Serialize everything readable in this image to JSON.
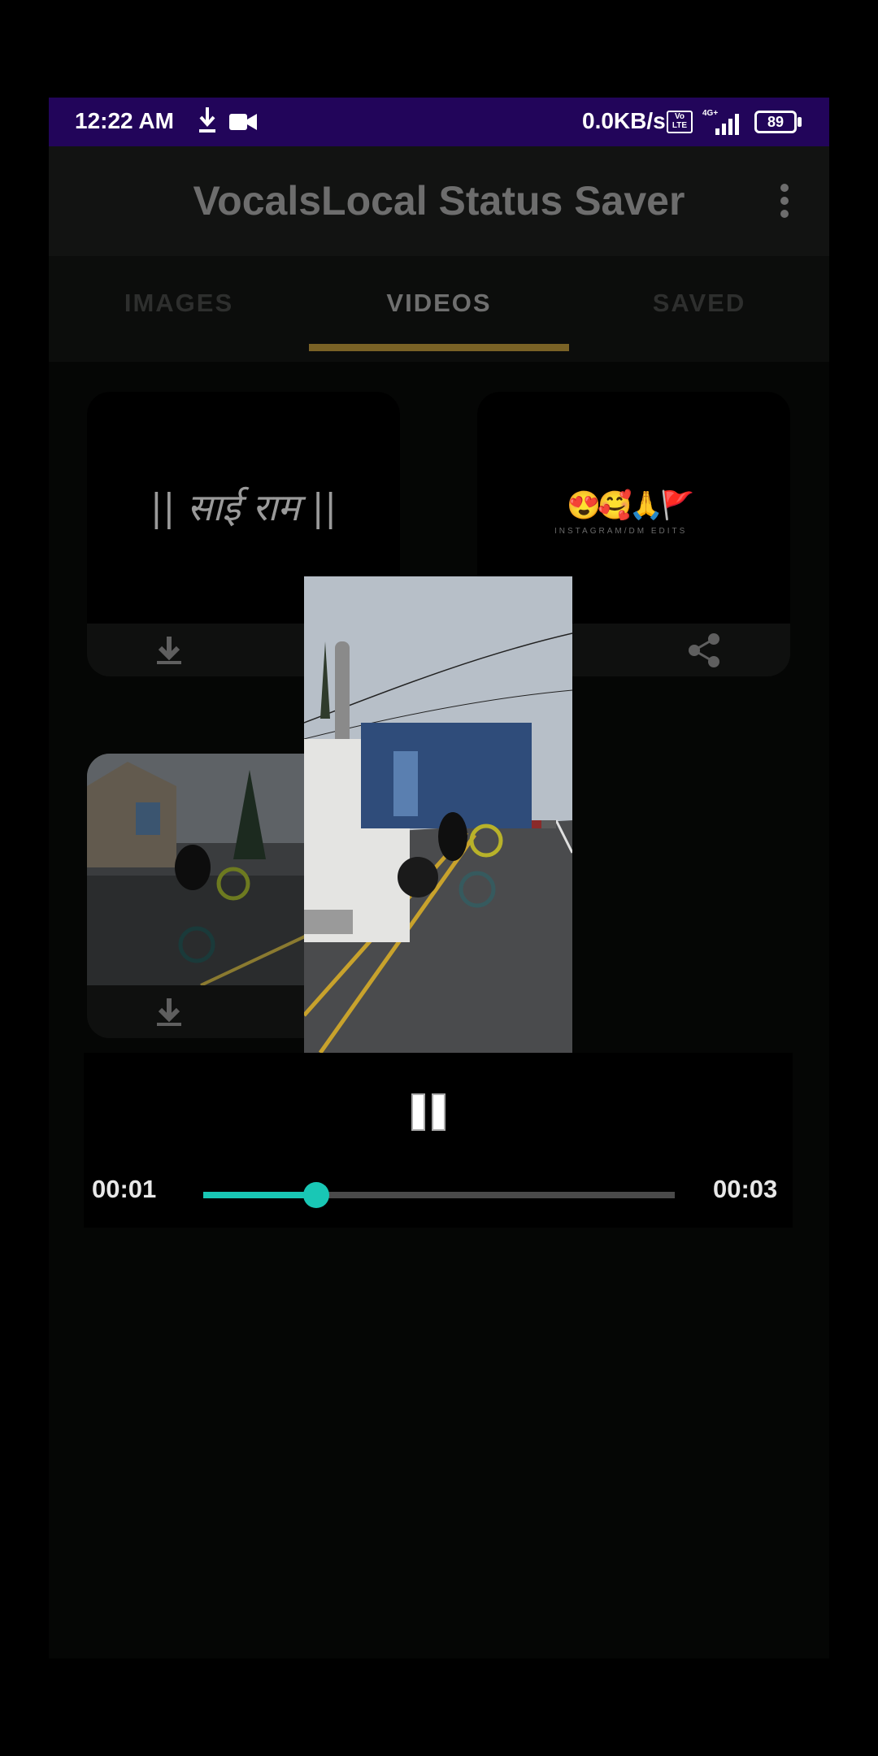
{
  "status_bar": {
    "time": "12:22 AM",
    "speed": "0.0KB/s",
    "volte": "Vo LTE",
    "network": "4G+",
    "battery": "89"
  },
  "app_bar": {
    "title": "VocalsLocal Status Saver",
    "menu_icon": "more-vert-icon"
  },
  "tabs": [
    {
      "label": "IMAGES",
      "active": false
    },
    {
      "label": "VIDEOS",
      "active": true
    },
    {
      "label": "SAVED",
      "active": false
    }
  ],
  "cards": [
    {
      "text": "|| साई राम ||",
      "action_icon": "download-icon"
    },
    {
      "text": "😍🥰🙏🚩",
      "subtext": "INSTAGRAM/DM EDITS",
      "action_icon": "share-icon"
    },
    {
      "action_icon": "download-icon"
    }
  ],
  "player": {
    "state": "playing",
    "control_icon": "pause-icon",
    "current_time": "00:01",
    "duration": "00:03",
    "progress": 0.24,
    "accent_color": "#19c7b5"
  },
  "colors": {
    "status_bar": "#22055a",
    "tab_indicator": "#7a6226"
  }
}
